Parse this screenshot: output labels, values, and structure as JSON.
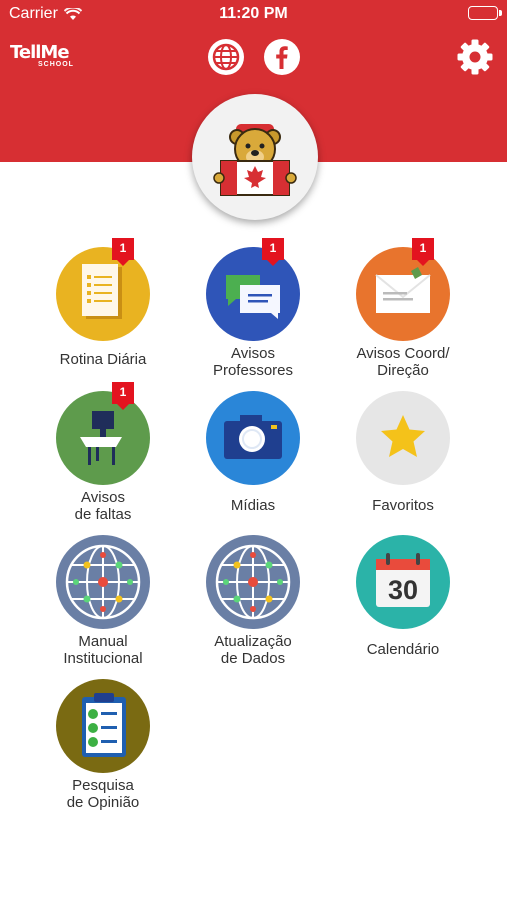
{
  "status_bar": {
    "carrier": "Carrier",
    "time": "11:20 PM"
  },
  "header": {
    "logo_top": "TellMe",
    "logo_bottom": "SCHOOL",
    "icons": [
      "globe-icon",
      "facebook-icon",
      "gear-icon"
    ],
    "colors": {
      "brand_red": "#d72f33",
      "badge_red": "#e3131f"
    }
  },
  "tiles": [
    {
      "label": "Rotina Diária",
      "badge": "1",
      "color": "#e9b321",
      "icon": "checklist-icon"
    },
    {
      "label": "Avisos\nProfessores",
      "badge": "1",
      "color": "#2f55b8",
      "icon": "chat-bubbles-icon"
    },
    {
      "label": "Avisos Coord/\nDireção",
      "badge": "1",
      "color": "#e8742d",
      "icon": "envelope-icon"
    },
    {
      "label": "Avisos\nde faltas",
      "badge": "1",
      "color": "#5e9b4c",
      "icon": "school-desk-icon"
    },
    {
      "label": "Mídias",
      "badge": "",
      "color": "#2a86d8",
      "icon": "camera-icon"
    },
    {
      "label": "Favoritos",
      "badge": "",
      "color": "#e6e6e6",
      "icon": "star-icon"
    },
    {
      "label": "Manual\nInstitucional",
      "badge": "",
      "color": "#6a7fa5",
      "icon": "network-globe-icon"
    },
    {
      "label": "Atualização\nde Dados",
      "badge": "",
      "color": "#6a7fa5",
      "icon": "network-globe-icon"
    },
    {
      "label": "Calendário",
      "badge": "",
      "color": "#2bb3a8",
      "icon": "calendar-icon",
      "day": "30"
    },
    {
      "label": "Pesquisa\nde Opinião",
      "badge": "",
      "color": "#7a6a12",
      "icon": "clipboard-icon"
    }
  ]
}
